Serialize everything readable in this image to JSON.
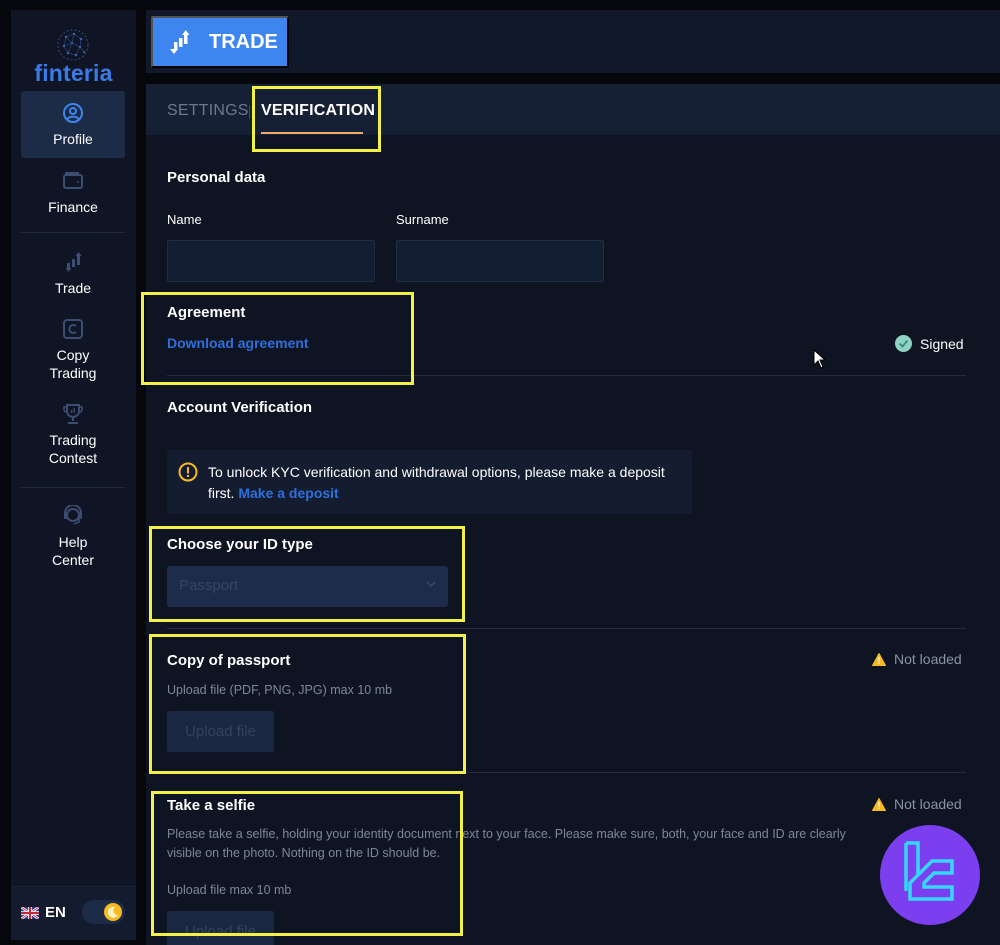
{
  "brand": {
    "name": "finteria",
    "accent_color": "#3a7be8"
  },
  "sidebar": {
    "items": [
      {
        "label": "Profile",
        "icon": "user-circle-icon",
        "active": true
      },
      {
        "label": "Finance",
        "icon": "wallet-icon",
        "active": false
      },
      {
        "label": "Trade",
        "icon": "trade-chart-icon",
        "active": false
      },
      {
        "label": "Copy Trading",
        "icon": "copy-trading-icon",
        "active": false
      },
      {
        "label": "Trading Contest",
        "icon": "trophy-icon",
        "active": false
      },
      {
        "label": "Help Center",
        "icon": "headset-icon",
        "active": false
      }
    ],
    "footer": {
      "language": "EN",
      "flag": "uk-flag-icon",
      "theme_toggle": "dark-mode-moon-icon"
    }
  },
  "topbar": {
    "trade_button_label": "TRADE"
  },
  "tabs": [
    {
      "label": "SETTINGS",
      "active": false
    },
    {
      "label": "VERIFICATION",
      "active": true
    }
  ],
  "personal_data": {
    "title": "Personal data",
    "name_label": "Name",
    "name_value": "",
    "surname_label": "Surname",
    "surname_value": ""
  },
  "agreement": {
    "title": "Agreement",
    "download_link": "Download agreement",
    "status": "Signed",
    "status_color": "#8fd3c6"
  },
  "account_verification": {
    "title": "Account Verification",
    "notice_text": "To unlock KYC verification and withdrawal options, please make a deposit first.",
    "notice_link": "Make a deposit",
    "id_type_label": "Choose your ID type",
    "id_type_value": "Passport"
  },
  "copy_of_passport": {
    "title": "Copy of passport",
    "description": "Upload file (PDF, PNG, JPG) max 10 mb",
    "upload_button": "Upload file",
    "status": "Not loaded"
  },
  "selfie": {
    "title": "Take a selfie",
    "description": "Please take a selfie, holding your identity document next to your face. Please make sure, both, your face and ID are clearly visible on the photo. Nothing on the ID should be.",
    "upload_note": "Upload file max 10 mb",
    "upload_button": "Upload file",
    "status": "Not loaded"
  },
  "colors": {
    "highlight": "#f4f04a",
    "warning": "#f7b924",
    "link": "#2f6fdc",
    "trade_button": "#3d86ef"
  }
}
